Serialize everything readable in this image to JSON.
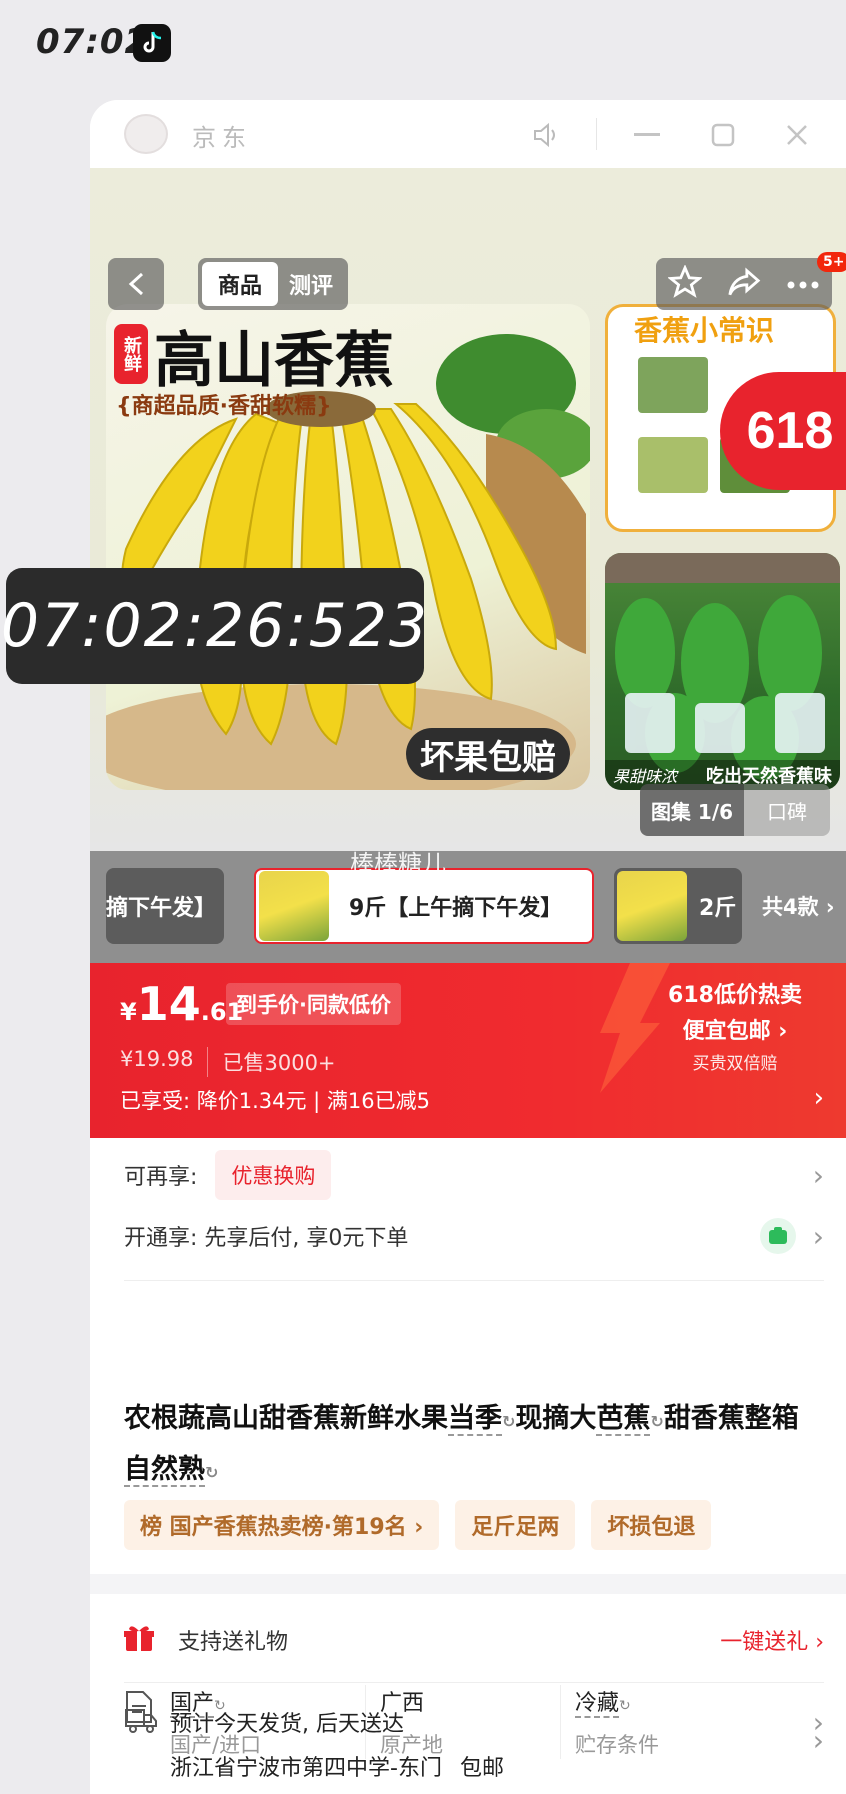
{
  "status_bar": {
    "time": "07:02"
  },
  "window": {
    "app_name": "京东"
  },
  "tabs": [
    {
      "label": "商品"
    },
    {
      "label": "测评"
    }
  ],
  "gallery": {
    "headline_tag": "新鲜",
    "headline": "高山香蕉",
    "headline_accent": "香蕉",
    "subheadline": "{商超品质·香甜软糯}",
    "guarantee": "坏果包赔",
    "side1_title": "香蕉小常识",
    "side2_caption_left": "果甜味浓",
    "side2_caption_right": "吃出天然香蕉味",
    "counter": "图集 1/6",
    "review_label": "口碑",
    "badge_618": "618",
    "msg_count": "5+"
  },
  "timer_overlay": "07:02:26:523",
  "watermark": "棒棒糖儿",
  "variants": [
    {
      "label": "摘下午发】"
    },
    {
      "label": "9斤【上午摘下午发】"
    },
    {
      "label": "2斤"
    }
  ],
  "variant_more": "共4款",
  "price": {
    "currency": "¥",
    "integer": "14",
    "decimal": ".61",
    "tag": "到手价·同款低价",
    "original": "¥19.98",
    "sold": "已售3000+",
    "discount_line": "已享受: 降价1.34元 | 满16已减5"
  },
  "promo": {
    "line1": "618低价热卖",
    "line2": "便宜包邮",
    "line3": "买贵双倍赔"
  },
  "extra_offer": {
    "label": "可再享:",
    "tag": "优惠换购"
  },
  "open_offer": {
    "label": "开通享: 先享后付, 享0元下单"
  },
  "title_parts": {
    "p1": "农根蔬高山甜香蕉新鲜水果",
    "k1": "当季",
    "p2": "现摘大",
    "k2": "芭蕉",
    "p3": "甜香蕉整箱",
    "k3": "自然熟"
  },
  "chips": [
    {
      "label": "榜 国产香蕉热卖榜·第19名 ›"
    },
    {
      "label": "足斤足两"
    },
    {
      "label": "坏损包退"
    }
  ],
  "gift": {
    "label": "支持送礼物",
    "action": "一键送礼"
  },
  "specs": [
    {
      "value": "国产",
      "key": "国产/进口"
    },
    {
      "value": "广西",
      "key": "原产地"
    },
    {
      "value": "冷藏",
      "key": "贮存条件"
    }
  ],
  "delivery": {
    "line1": "预计今天发货, 后天送达",
    "line2": "浙江省宁波市第四中学-东门",
    "free_shipping": "包邮"
  },
  "colors": {
    "accent": "#e8232d",
    "chip_bg": "#fdf1e6",
    "chip_text": "#b06a2a"
  }
}
